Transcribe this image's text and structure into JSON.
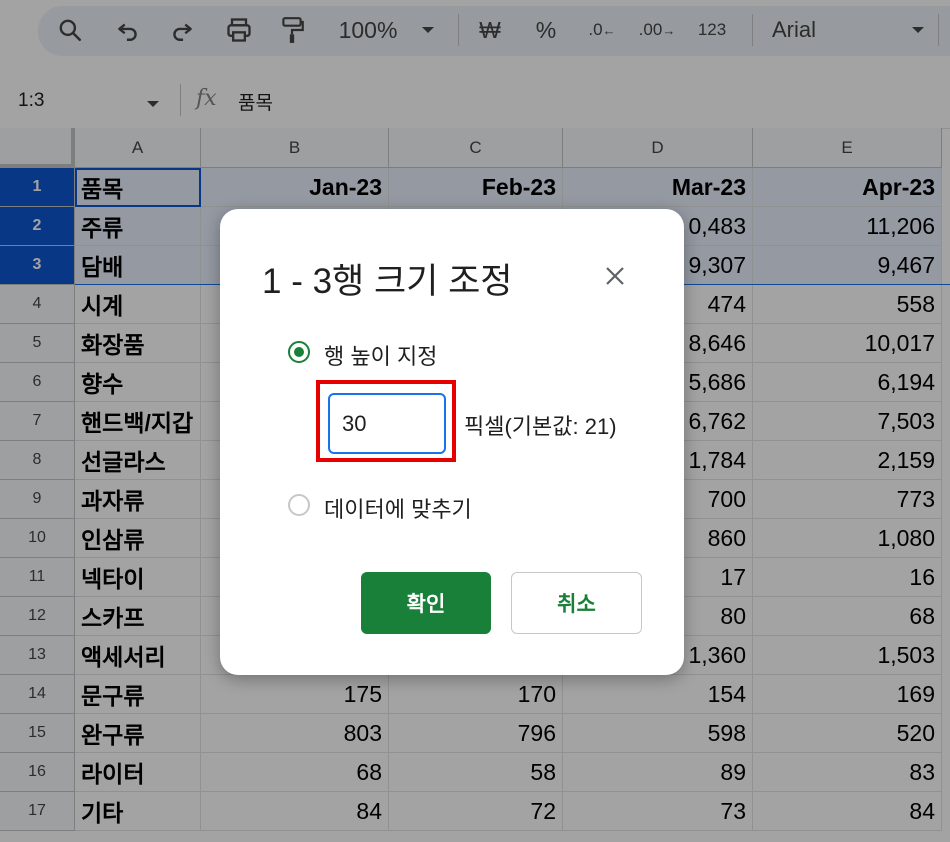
{
  "toolbar": {
    "zoom": "100%",
    "currency": "₩",
    "percent": "%",
    "decrease_decimal": ".0",
    "increase_decimal": ".00",
    "number_format": "123",
    "font": "Arial",
    "icons": [
      "search-icon",
      "undo-icon",
      "redo-icon",
      "print-icon",
      "paint-format-icon",
      "chevron-down-icon"
    ]
  },
  "formula_bar": {
    "cell_ref": "1:3",
    "fx": "fx",
    "value": "품목"
  },
  "sheet": {
    "columns": [
      "A",
      "B",
      "C",
      "D",
      "E"
    ],
    "rows": [
      {
        "num": "1",
        "a": "품목",
        "b": "Jan-23",
        "c": "Feb-23",
        "d": "Mar-23",
        "e": "Apr-23"
      },
      {
        "num": "2",
        "a": "주류",
        "b": "",
        "c": "",
        "d": "0,483",
        "e": "11,206"
      },
      {
        "num": "3",
        "a": "담배",
        "b": "",
        "c": "",
        "d": "9,307",
        "e": "9,467"
      },
      {
        "num": "4",
        "a": "시계",
        "b": "",
        "c": "",
        "d": "474",
        "e": "558"
      },
      {
        "num": "5",
        "a": "화장품",
        "b": "",
        "c": "",
        "d": "8,646",
        "e": "10,017"
      },
      {
        "num": "6",
        "a": "향수",
        "b": "",
        "c": "",
        "d": "5,686",
        "e": "6,194"
      },
      {
        "num": "7",
        "a": "핸드백/지갑",
        "b": "",
        "c": "",
        "d": "6,762",
        "e": "7,503"
      },
      {
        "num": "8",
        "a": "선글라스",
        "b": "",
        "c": "",
        "d": "1,784",
        "e": "2,159"
      },
      {
        "num": "9",
        "a": "과자류",
        "b": "",
        "c": "",
        "d": "700",
        "e": "773"
      },
      {
        "num": "10",
        "a": "인삼류",
        "b": "",
        "c": "",
        "d": "860",
        "e": "1,080"
      },
      {
        "num": "11",
        "a": "넥타이",
        "b": "",
        "c": "",
        "d": "17",
        "e": "16"
      },
      {
        "num": "12",
        "a": "스카프",
        "b": "",
        "c": "",
        "d": "80",
        "e": "68"
      },
      {
        "num": "13",
        "a": "액세서리",
        "b": "",
        "c": "",
        "d": "1,360",
        "e": "1,503"
      },
      {
        "num": "14",
        "a": "문구류",
        "b": "175",
        "c": "170",
        "d": "154",
        "e": "169"
      },
      {
        "num": "15",
        "a": "완구류",
        "b": "803",
        "c": "796",
        "d": "598",
        "e": "520"
      },
      {
        "num": "16",
        "a": "라이터",
        "b": "68",
        "c": "58",
        "d": "89",
        "e": "83"
      },
      {
        "num": "17",
        "a": "기타",
        "b": "84",
        "c": "72",
        "d": "73",
        "e": "84"
      }
    ]
  },
  "dialog": {
    "title": "1 - 3행 크기 조정",
    "option_specify": "행 높이 지정",
    "height_value": "30",
    "unit_label": "픽셀(기본값: 21)",
    "option_fit": "데이터에 맞추기",
    "ok": "확인",
    "cancel": "취소"
  },
  "colors": {
    "accent_green": "#188038",
    "selection_blue": "#0b57d0",
    "highlight_red": "#e60000"
  }
}
